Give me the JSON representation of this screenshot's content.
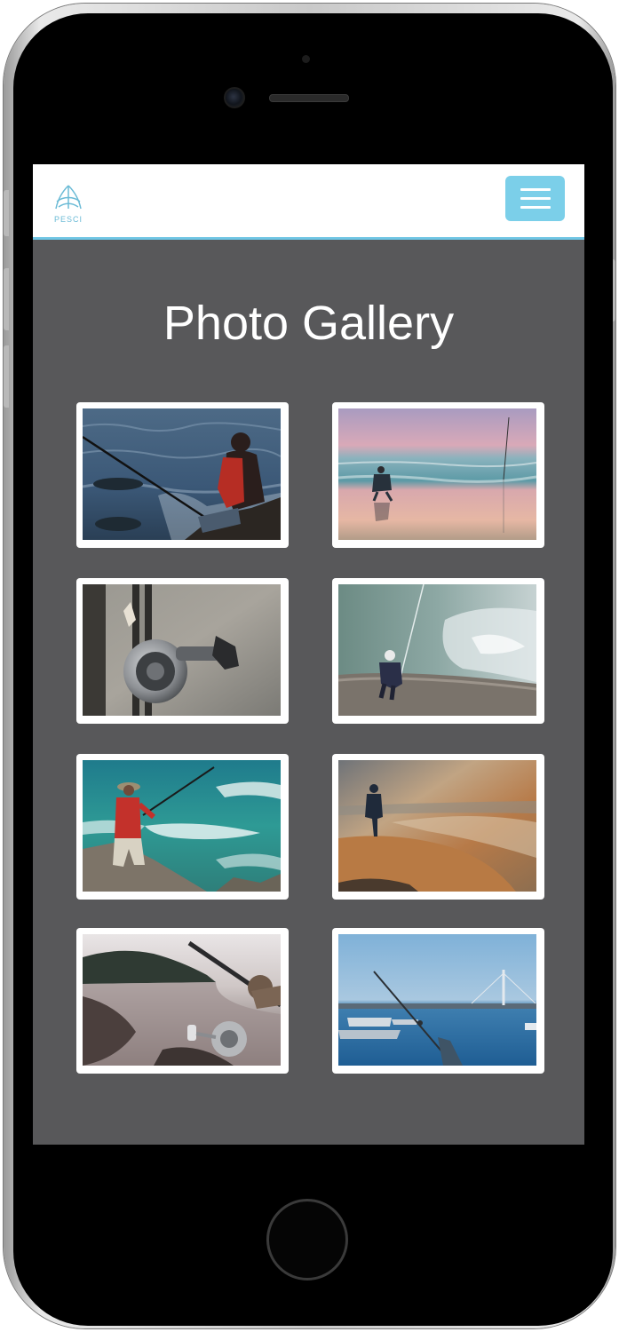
{
  "app": {
    "brand": "PESCI",
    "page_title": "Photo Gallery"
  },
  "navbar": {
    "logo_icon": "fish-fin-logo-icon",
    "menu_icon": "hamburger-menu-icon"
  },
  "colors": {
    "accent": "#7bcfe9",
    "screen_background": "#58585a",
    "navbar_background": "#ffffff"
  },
  "gallery": {
    "photos": [
      {
        "name": "fisherman-red-jacket-rocks"
      },
      {
        "name": "fisherman-pink-sunset-beach"
      },
      {
        "name": "fishing-reel-closeup"
      },
      {
        "name": "fisherman-waves-rocks"
      },
      {
        "name": "fisherman-red-shirt-green-sea"
      },
      {
        "name": "silhouette-golden-shore"
      },
      {
        "name": "reel-handheld-coast"
      },
      {
        "name": "rod-harbor-blue-bridge"
      }
    ]
  }
}
